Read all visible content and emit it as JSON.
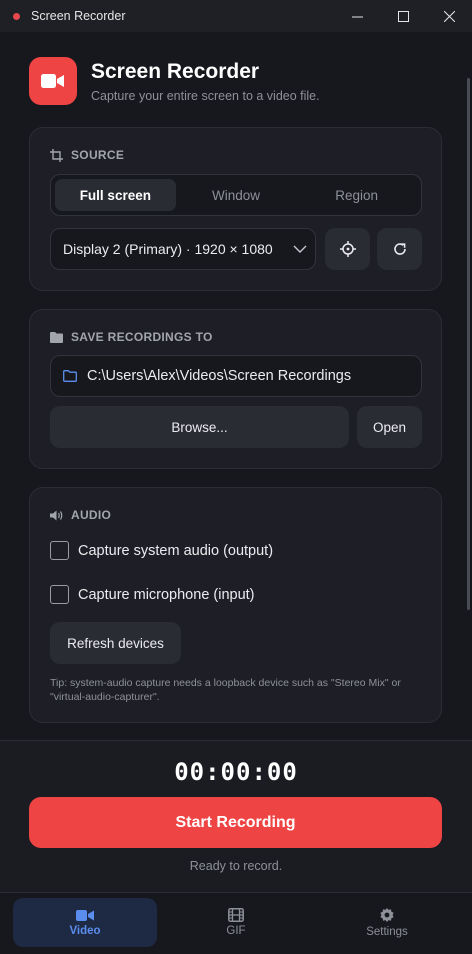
{
  "window": {
    "title": "Screen Recorder"
  },
  "header": {
    "title": "Screen Recorder",
    "subtitle": "Capture your entire screen to a video file."
  },
  "source": {
    "heading": "SOURCE",
    "modes": [
      {
        "label": "Full screen",
        "active": true
      },
      {
        "label": "Window",
        "active": false
      },
      {
        "label": "Region",
        "active": false
      }
    ],
    "display": "Display 2 (Primary)  ·  1920 × 1080"
  },
  "save": {
    "heading": "SAVE RECORDINGS TO",
    "path": "C:\\Users\\Alex\\Videos\\Screen Recordings",
    "browse_label": "Browse...",
    "open_label": "Open"
  },
  "audio": {
    "heading": "AUDIO",
    "system_audio_label": "Capture system audio (output)",
    "system_audio_checked": false,
    "microphone_label": "Capture microphone (input)",
    "microphone_checked": false,
    "refresh_label": "Refresh devices",
    "tip": "Tip: system-audio capture needs a loopback device such as \"Stereo Mix\" or \"virtual-audio-capturer\"."
  },
  "footer": {
    "timer": "00:00:00",
    "record_label": "Start Recording",
    "status": "Ready to record."
  },
  "nav": {
    "video_label": "Video",
    "gif_label": "GIF",
    "settings_label": "Settings",
    "active": "Video"
  },
  "colors": {
    "accent": "#ef4444",
    "active_tab": "#5b8def",
    "background": "#17181d",
    "card": "#1e1f26"
  }
}
